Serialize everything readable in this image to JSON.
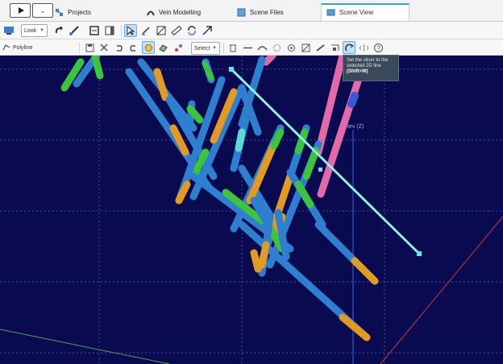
{
  "tabs": [
    {
      "label": "Projects",
      "icon": "projects-icon"
    },
    {
      "label": "Vein Modelling",
      "icon": "vein-icon"
    },
    {
      "label": "Scene Files",
      "icon": "scene-files-icon"
    },
    {
      "label": "Scene View",
      "icon": "scene-view-icon",
      "active": true
    }
  ],
  "toolbar1": {
    "look_label": "Look"
  },
  "toolbar2": {
    "mode_label": "Polyline",
    "select_label": "Select"
  },
  "tooltip": {
    "text": "Set the slicer to the selected 2D line",
    "shortcut": "(Shift+W)"
  },
  "scene": {
    "label": "Rev (Z)",
    "colors": {
      "background": "#0a0a50",
      "drill_blue": "#2f7fd0",
      "drill_green": "#3cc43c",
      "drill_orange": "#e39a22",
      "drill_pink": "#e36aa8",
      "line_cyan": "#5fe8e8",
      "axis_red": "#c43a3a",
      "axis_green": "#4ea84e"
    }
  }
}
